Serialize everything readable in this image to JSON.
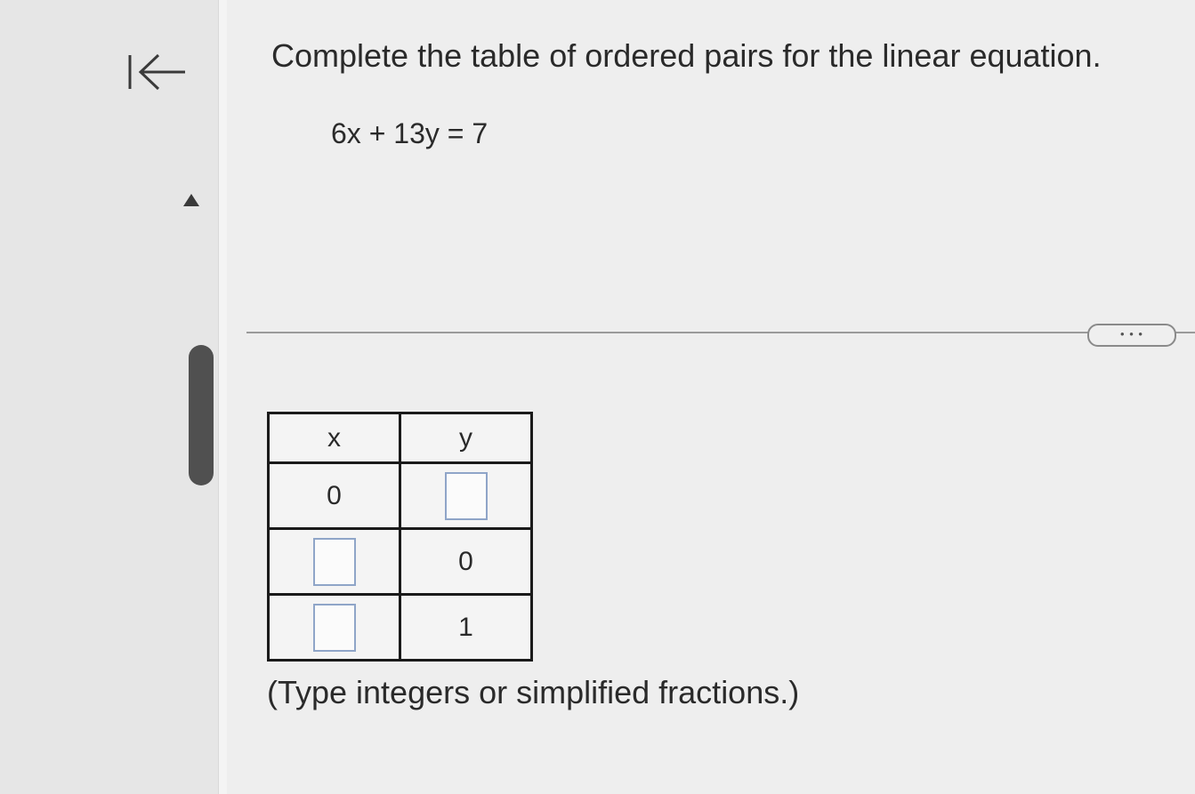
{
  "nav": {
    "back_icon": "first-page-arrow-icon",
    "scroll_up_icon": "triangle-up-icon"
  },
  "question": {
    "prompt": "Complete the table of ordered pairs for the linear equation.",
    "equation": "6x + 13y = 7"
  },
  "more_button": {
    "label": "• • •"
  },
  "table": {
    "headers": [
      "x",
      "y"
    ],
    "rows": [
      {
        "x": "0",
        "y": ""
      },
      {
        "x": "",
        "y": "0"
      },
      {
        "x": "",
        "y": "1"
      }
    ]
  },
  "hint": "(Type integers or simplified fractions.)"
}
